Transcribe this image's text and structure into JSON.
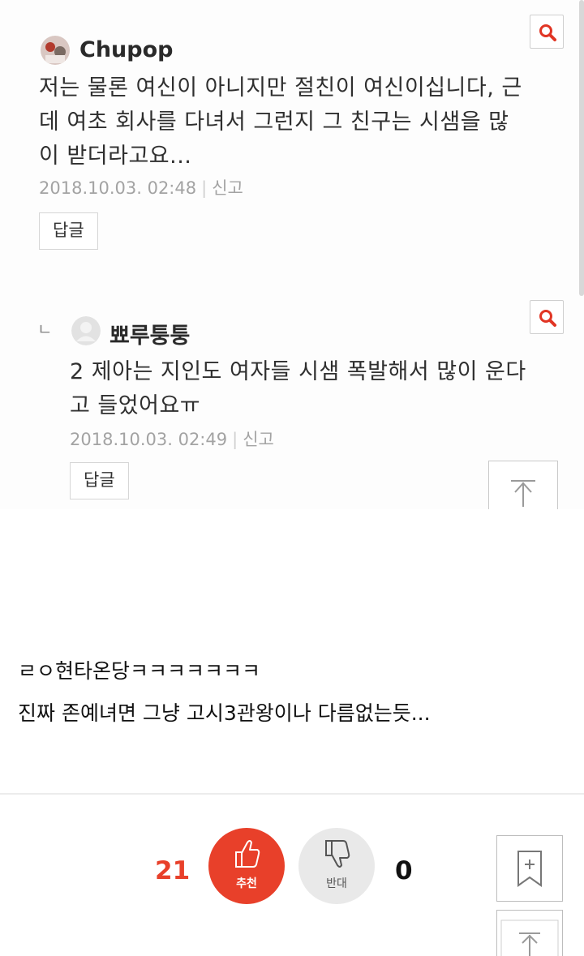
{
  "comments": [
    {
      "username": "Chupop",
      "lines": [
        "저는 물론 여신이 아니지만 절친이 여신이십니다, 근",
        "데 여초 회사를 다녀서 그런지 그 친구는 시샘을 많",
        "이 받더라고요..."
      ],
      "date": "2018.10.03. 02:48",
      "report_label": "신고",
      "reply_label": "답글"
    },
    {
      "reply_marker": "ㄴ",
      "username": "뾰루퉁퉁",
      "lines": [
        "2 제아는 지인도 여자들 시샘 폭발해서 많이 운다",
        "고 들었어요ㅠ"
      ],
      "date": "2018.10.03. 02:49",
      "report_label": "신고",
      "reply_label": "답글"
    }
  ],
  "post": {
    "lines": [
      "ㄹㅇ현타온당ㅋㅋㅋㅋㅋㅋㅋ",
      "진짜 존예녀면 그냥 고시3관왕이나 다름없는듯..."
    ]
  },
  "votes": {
    "up_count": "21",
    "up_label": "추천",
    "down_count": "0",
    "down_label": "반대"
  },
  "colors": {
    "accent": "#e8402a",
    "down_bg": "#e9e9e9"
  }
}
